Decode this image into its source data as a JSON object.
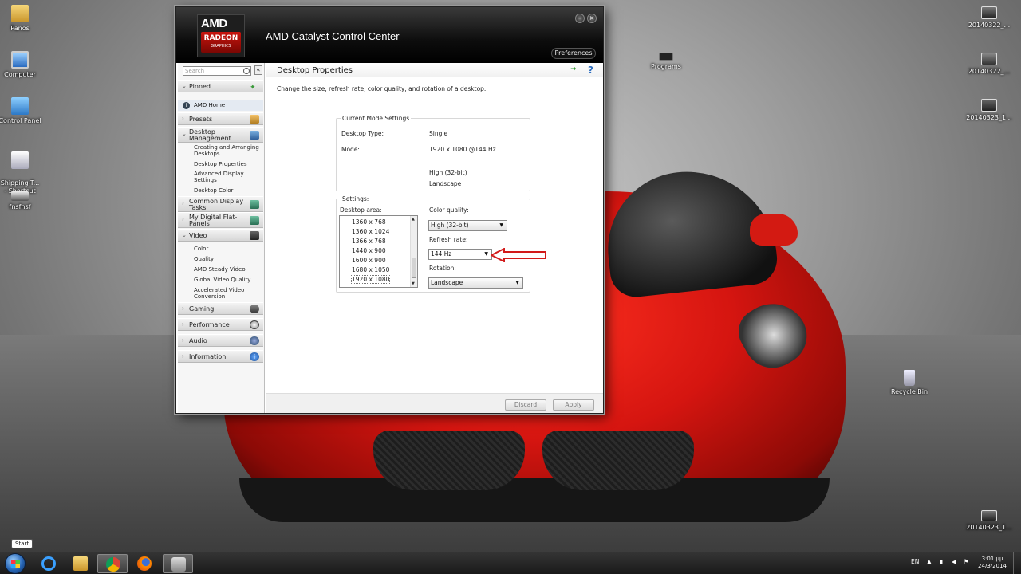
{
  "desktop": {
    "icons": [
      {
        "label": "Panos"
      },
      {
        "label": "Computer"
      },
      {
        "label": "Control Panel"
      },
      {
        "label": "Shipping-T...\n- Shortcut"
      },
      {
        "label": "fnsfnsf"
      },
      {
        "label": "Programs"
      },
      {
        "label": "20140322_..."
      },
      {
        "label": "20140322_..."
      },
      {
        "label": "20140323_1..."
      },
      {
        "label": "Recycle Bin"
      },
      {
        "label": "20140323_1..."
      }
    ]
  },
  "window": {
    "title": "AMD Catalyst Control Center",
    "logo_brand": "AMD",
    "logo_product": "RADEON",
    "logo_sub": "GRAPHICS",
    "preferences_label": "Preferences",
    "minimize_glyph": "–",
    "close_glyph": "×"
  },
  "sidebar": {
    "search_placeholder": "Search",
    "collapse_glyph": "«",
    "categories": {
      "pinned": "Pinned",
      "amd_home": "AMD Home",
      "presets": "Presets",
      "desktop_management_1": "Desktop",
      "desktop_management_2": "Management",
      "common_display_1": "Common Display",
      "common_display_2": "Tasks",
      "digital_flat_1": "My Digital Flat-",
      "digital_flat_2": "Panels",
      "video": "Video",
      "gaming": "Gaming",
      "performance": "Performance",
      "audio": "Audio",
      "information": "Information"
    },
    "desktop_sub": {
      "creating_1": "Creating and Arranging",
      "creating_2": "Desktops",
      "properties": "Desktop Properties",
      "advanced_1": "Advanced Display",
      "advanced_2": "Settings",
      "color": "Desktop Color"
    },
    "video_sub": {
      "color": "Color",
      "quality": "Quality",
      "steady": "AMD Steady Video",
      "global": "Global Video Quality",
      "accel_1": "Accelerated Video",
      "accel_2": "Conversion"
    }
  },
  "main": {
    "title": "Desktop Properties",
    "description": "Change the size, refresh rate, color quality, and rotation of a desktop.",
    "current_mode": {
      "legend": "Current Mode Settings",
      "desktop_type_label": "Desktop Type:",
      "desktop_type_value": "Single",
      "mode_label": "Mode:",
      "mode_value": "1920 x 1080 @144 Hz",
      "color_value": "High (32-bit)",
      "orientation_value": "Landscape"
    },
    "settings": {
      "legend": "Settings:",
      "desktop_area_label": "Desktop area:",
      "resolutions": [
        "1360 x 768",
        "1360 x 1024",
        "1366 x 768",
        "1440 x 900",
        "1600 x 900",
        "1680 x 1050",
        "1920 x 1080"
      ],
      "selected_resolution": "1920 x 1080",
      "color_quality_label": "Color quality:",
      "color_quality_value": "High (32-bit)",
      "refresh_rate_label": "Refresh rate:",
      "refresh_rate_value": "144 Hz",
      "rotation_label": "Rotation:",
      "rotation_value": "Landscape"
    },
    "discard_label": "Discard",
    "apply_label": "Apply"
  },
  "taskbar": {
    "start_tooltip": "Start",
    "language": "EN",
    "time": "3:01 μμ",
    "date": "24/3/2014"
  },
  "colors": {
    "annotation_arrow": "#d21a1a",
    "window_header": "#0d0d0d",
    "accent_red": "#c8150e"
  }
}
